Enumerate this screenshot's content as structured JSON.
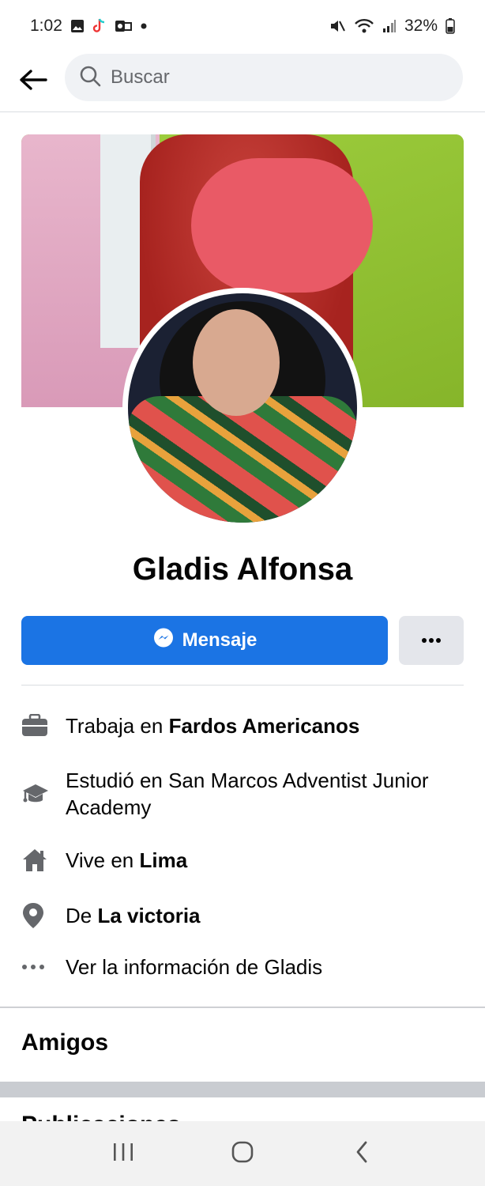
{
  "status_bar": {
    "time": "1:02",
    "battery": "32%",
    "left_icons": [
      "gallery-icon",
      "tiktok-icon",
      "outlook-icon",
      "dot-icon"
    ],
    "right_icons": [
      "mute-icon",
      "wifi-icon",
      "signal-icon",
      "battery-icon"
    ]
  },
  "topbar": {
    "search_placeholder": "Buscar"
  },
  "profile": {
    "name": "Gladis Alfonsa"
  },
  "actions": {
    "message_label": "Mensaje",
    "more_label": "..."
  },
  "details": {
    "work_prefix": "Trabaja en ",
    "work_place": "Fardos Americanos",
    "study_text": "Estudió en San Marcos Adventist Junior Academy",
    "lives_prefix": "Vive en ",
    "lives_place": "Lima",
    "from_prefix": "De ",
    "from_place": "La victoria",
    "see_info": "Ver la información de Gladis"
  },
  "sections": {
    "friends": "Amigos",
    "next_partial": "Publicaciones"
  },
  "colors": {
    "accent": "#1b74e4",
    "secondary_button": "#e4e6eb",
    "icon_gray": "#65676b"
  }
}
